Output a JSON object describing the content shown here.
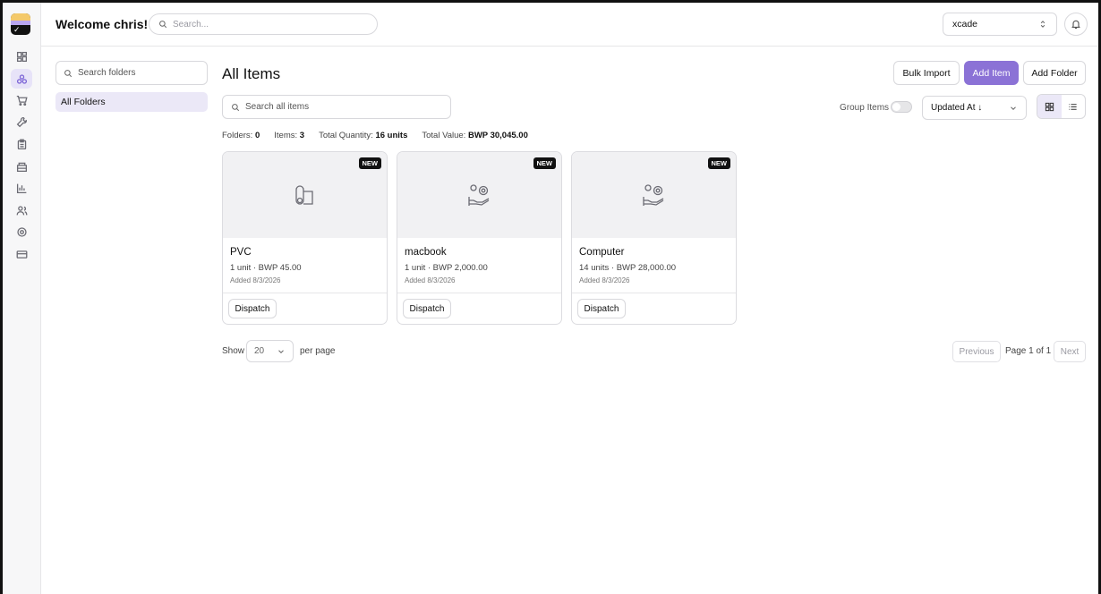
{
  "header": {
    "welcome": "Welcome chris!",
    "search_placeholder": "Search...",
    "org": "xcade"
  },
  "rail": {
    "icons": [
      "dashboard-icon",
      "items-icon",
      "cart-icon",
      "tools-icon",
      "clipboard-icon",
      "archive-icon",
      "chart-icon",
      "users-icon",
      "settings-icon",
      "card-icon"
    ],
    "active": "items-icon"
  },
  "folders": {
    "search_placeholder": "Search folders",
    "all_label": "All Folders"
  },
  "main": {
    "title": "All Items",
    "buttons": {
      "bulk_import": "Bulk Import",
      "add_item": "Add Item",
      "add_folder": "Add Folder"
    },
    "search_placeholder": "Search all items",
    "group_label": "Group Items",
    "group_enabled": false,
    "sort": "Updated At ↓",
    "view": "grid"
  },
  "stats": {
    "folders_label": "Folders:",
    "folders": "0",
    "items_label": "Items:",
    "items": "3",
    "qty_label": "Total Quantity:",
    "qty": "16 units",
    "value_label": "Total Value:",
    "value": "BWP 30,045.00"
  },
  "items": [
    {
      "badge": "NEW",
      "name": "PVC",
      "meta": "1 unit · BWP 45.00",
      "added": "Added 8/3/2026",
      "action": "Dispatch",
      "icon": "pipe-icon"
    },
    {
      "badge": "NEW",
      "name": "macbook",
      "meta": "1 unit · BWP 2,000.00",
      "added": "Added 8/3/2026",
      "action": "Dispatch",
      "icon": "service-hand-icon"
    },
    {
      "badge": "NEW",
      "name": "Computer",
      "meta": "14 units · BWP 28,000.00",
      "added": "Added 8/3/2026",
      "action": "Dispatch",
      "icon": "service-hand-icon"
    }
  ],
  "pagination": {
    "show": "Show",
    "per_page_value": "20",
    "per_page": "per page",
    "previous": "Previous",
    "info": "Page 1 of 1",
    "next": "Next"
  },
  "colors": {
    "accent": "#8b72d6",
    "accent_soft": "#ebe8f7"
  }
}
